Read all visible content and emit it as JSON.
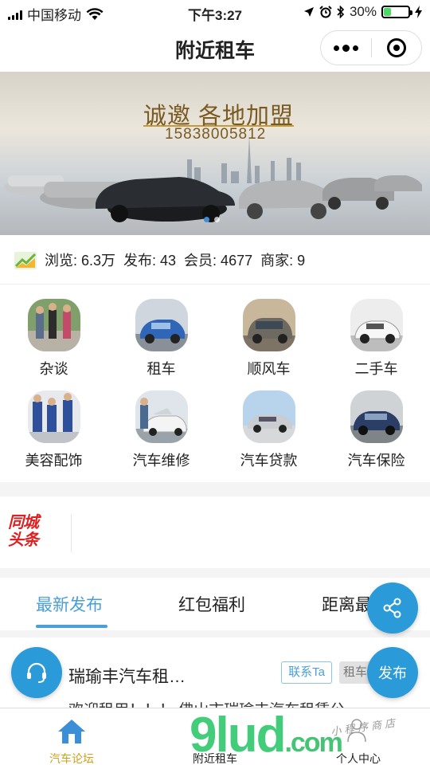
{
  "status_bar": {
    "carrier": "中国移动",
    "time": "下午3:27",
    "battery": "30%",
    "battery_level": 0.3
  },
  "nav": {
    "title": "附近租车"
  },
  "banner": {
    "title": "诚邀 各地加盟",
    "phone": "15838005812",
    "slide_count": 2,
    "active_slide": 0
  },
  "stats": {
    "text": "浏览: 6.3万  发布: 43  会员: 4677  商家: 9"
  },
  "categories": [
    {
      "label": "杂谈"
    },
    {
      "label": "租车"
    },
    {
      "label": "顺风车"
    },
    {
      "label": "二手车"
    },
    {
      "label": "美容配饰"
    },
    {
      "label": "汽车维修"
    },
    {
      "label": "汽车贷款"
    },
    {
      "label": "汽车保险"
    }
  ],
  "headline": {
    "logo_line1": "同城",
    "logo_line2": "头条"
  },
  "tabs": [
    {
      "label": "最新发布",
      "active": true
    },
    {
      "label": "红包福利",
      "active": false
    },
    {
      "label": "距离最",
      "active": false
    }
  ],
  "post": {
    "title": "瑞瑜丰汽车租…",
    "contact_badge": "联系Ta",
    "type_badge": "租车",
    "excerpt": "欢迎租用！！！ 佛山市瑞瑜丰汽车租赁公"
  },
  "fab": {
    "publish": "发布"
  },
  "tabbar": [
    {
      "label": "汽车论坛",
      "active": true
    },
    {
      "label": "附近租车",
      "active": false
    },
    {
      "label": "个人中心",
      "active": false
    }
  ],
  "watermark": {
    "text": "9lud",
    "suffix": ".com",
    "sub": "小程序商店"
  },
  "colors": {
    "accent": "#4a9fd8",
    "fab": "#2a9ad9",
    "tabbar_active": "#d1a019"
  }
}
